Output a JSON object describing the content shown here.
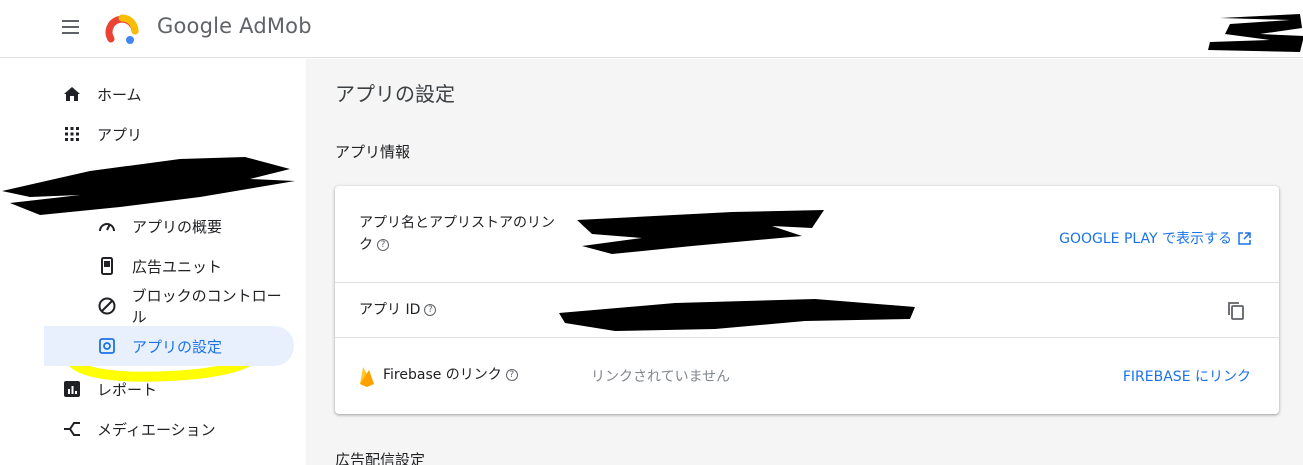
{
  "header": {
    "brand_name": "Google AdMob"
  },
  "sidebar": {
    "items": [
      {
        "label": "ホーム",
        "icon": "home-icon"
      },
      {
        "label": "アプリ",
        "icon": "apps-grid-icon"
      },
      {
        "label": "アプリの概要",
        "icon": "speedometer-icon"
      },
      {
        "label": "広告ユニット",
        "icon": "phone-icon"
      },
      {
        "label": "ブロックのコントロール",
        "icon": "block-icon"
      },
      {
        "label": "アプリの設定",
        "icon": "settings-gear-icon"
      },
      {
        "label": "レポート",
        "icon": "bar-chart-icon"
      },
      {
        "label": "メディエーション",
        "icon": "mediation-icon"
      }
    ]
  },
  "main": {
    "page_title": "アプリの設定",
    "section_app_info": "アプリ情報",
    "section_ad_delivery": "広告配信設定",
    "rows": {
      "app_name": {
        "label_line1": "アプリ名とアプリストアのリン",
        "label_line2": "ク",
        "link": "GOOGLE PLAY で表示する"
      },
      "app_id": {
        "label": "アプリ ID"
      },
      "firebase": {
        "label": "Firebase のリンク",
        "status": "リンクされていません",
        "link": "FIREBASE にリンク"
      }
    }
  },
  "colors": {
    "accent": "#1a73e8",
    "highlight": "#ffff00",
    "firebase_yellow": "#ffca28"
  }
}
